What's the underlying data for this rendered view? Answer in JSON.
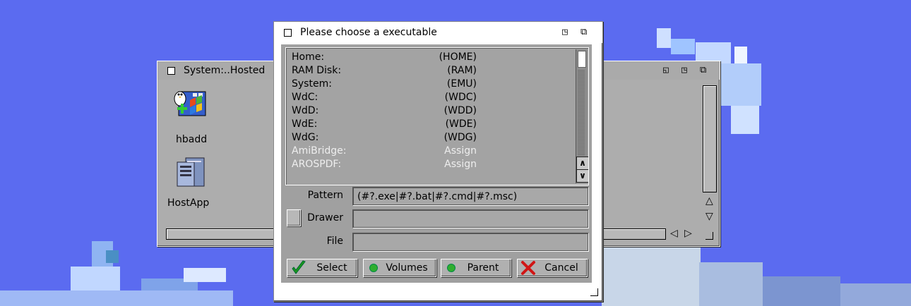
{
  "requester": {
    "title": "Please choose a executable",
    "volumes": [
      {
        "name": "Home:",
        "device": "(HOME)",
        "dim": false
      },
      {
        "name": "RAM Disk:",
        "device": "(RAM)",
        "dim": false
      },
      {
        "name": "System:",
        "device": "(EMU)",
        "dim": false
      },
      {
        "name": "WdC:",
        "device": "(WDC)",
        "dim": false
      },
      {
        "name": "WdD:",
        "device": "(WDD)",
        "dim": false
      },
      {
        "name": "WdE:",
        "device": "(WDE)",
        "dim": false
      },
      {
        "name": "WdG:",
        "device": "(WDG)",
        "dim": false
      },
      {
        "name": "AmiBridge:",
        "device": "Assign",
        "dim": true
      },
      {
        "name": "AROSPDF:",
        "device": "Assign",
        "dim": true
      }
    ],
    "pattern_label": "Pattern",
    "pattern_value": "(#?.exe|#?.bat|#?.cmd|#?.msc)",
    "drawer_label": "Drawer",
    "drawer_value": "",
    "file_label": "File",
    "file_value": "",
    "buttons": {
      "select": "Select",
      "volumes": "Volumes",
      "parent": "Parent",
      "cancel": "Cancel"
    }
  },
  "drawer_window": {
    "title": "System:..Hosted",
    "icons": [
      {
        "label": "hbadd",
        "icon": "app-installer-icon"
      },
      {
        "label": "HostApp",
        "icon": "computer-tower-icon"
      }
    ]
  },
  "colors": {
    "desktop": "#5b6bf0",
    "window_gray": "#aaaaaa",
    "check_green": "#1a9a1a",
    "cancel_red": "#d01515"
  }
}
